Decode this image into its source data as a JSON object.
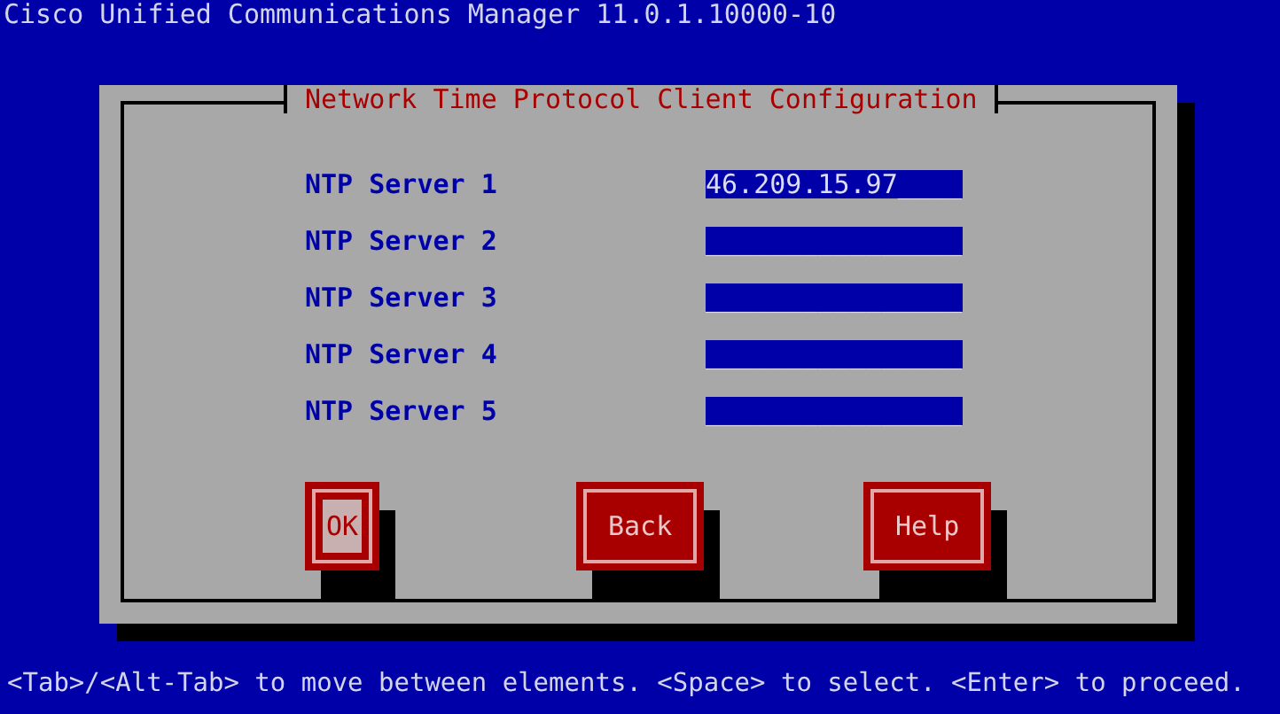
{
  "screen_title": "Cisco Unified Communications Manager 11.0.1.10000-10",
  "dialog": {
    "title": "Network Time Protocol Client Configuration",
    "fields": [
      {
        "label": "NTP Server 1",
        "value": "46.209.15.97____"
      },
      {
        "label": "NTP Server 2",
        "value": "________________"
      },
      {
        "label": "NTP Server 3",
        "value": "________________"
      },
      {
        "label": "NTP Server 4",
        "value": "________________"
      },
      {
        "label": "NTP Server 5",
        "value": "________________"
      }
    ],
    "buttons": [
      {
        "label": "OK",
        "focused": true
      },
      {
        "label": "Back",
        "focused": false
      },
      {
        "label": "Help",
        "focused": false
      }
    ]
  },
  "status_bar": "<Tab>/<Alt-Tab> to move between elements. <Space> to select. <Enter> to proceed."
}
